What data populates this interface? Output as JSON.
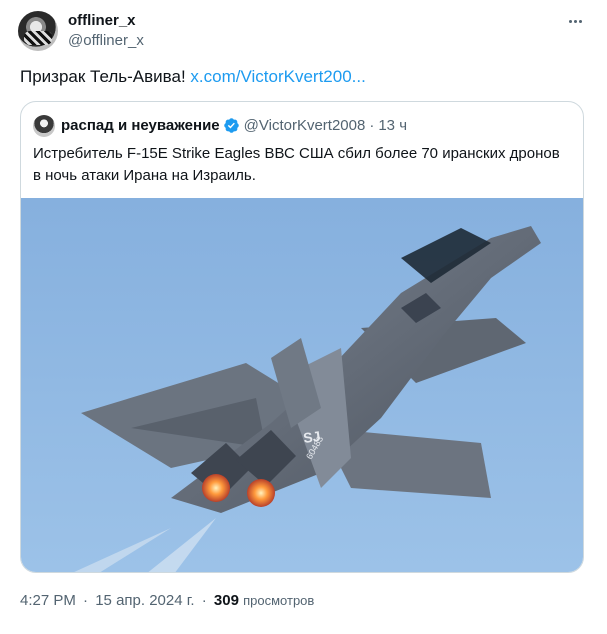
{
  "author": {
    "name": "offliner_x",
    "handle": "@offliner_x"
  },
  "tweet": {
    "text": "Призрак Тель-Авива!",
    "link": "x.com/VictorKvert200..."
  },
  "quoted": {
    "name": "распад и неуважение",
    "handle": "@VictorKvert2008",
    "dot": "·",
    "time": "13 ч",
    "text": "Истребитель F-15E Strike Eagles ВВС США сбил более 70 иранских дронов в ночь атаки Ирана на Израиль.",
    "photo_markings": {
      "tail_code": "SJ",
      "serial": "60483"
    }
  },
  "meta": {
    "time": "4:27 PM",
    "sep": "·",
    "date": "15 апр. 2024 г.",
    "sep2": "·",
    "views_count": "309",
    "views_label": "просмотров"
  },
  "colors": {
    "accent": "#1d9bf0",
    "text": "#0f1419",
    "secondary": "#536471",
    "border": "#cfd9de",
    "sky": "#8fb7e0"
  },
  "icons": {
    "more": "more-horizontal-icon",
    "verified": "verified-badge-icon"
  }
}
